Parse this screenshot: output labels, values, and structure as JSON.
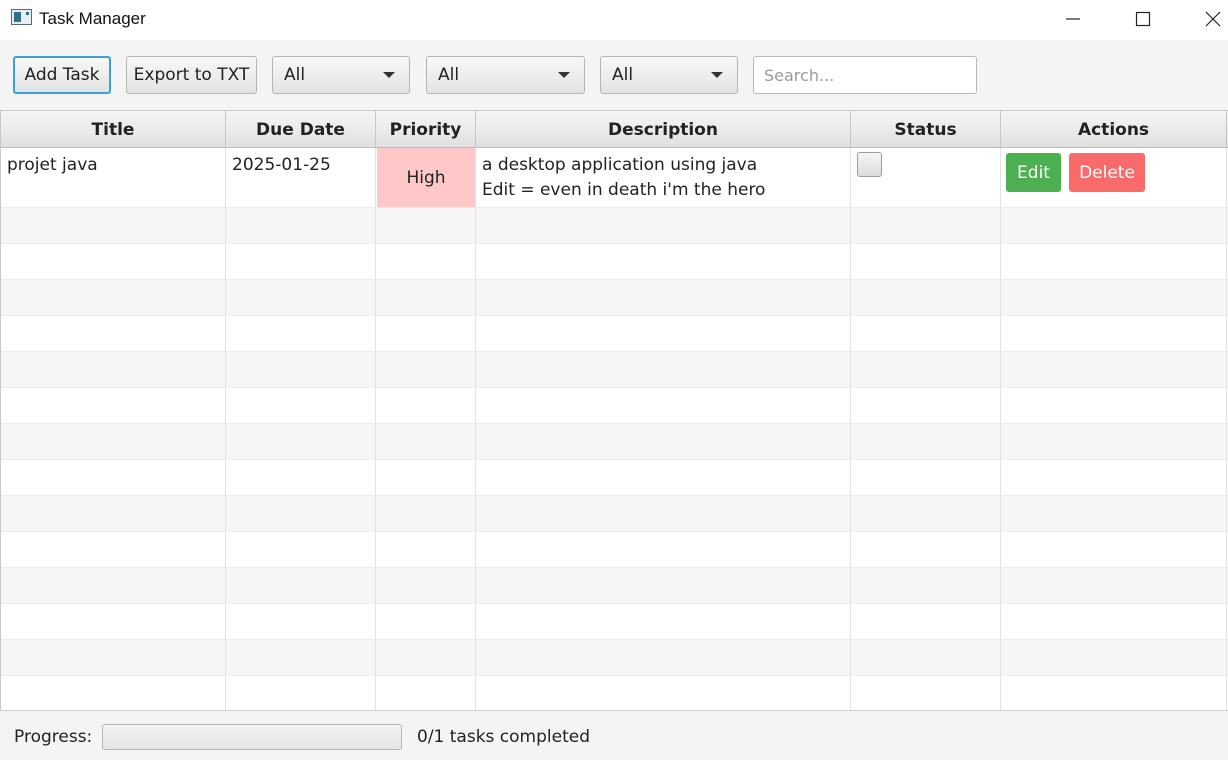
{
  "window": {
    "title": "Task Manager",
    "icon": "app-window-icon"
  },
  "toolbar": {
    "add_label": "Add Task",
    "export_label": "Export to TXT",
    "filter1_value": "All",
    "filter2_value": "All",
    "filter3_value": "All",
    "search_placeholder": "Search...",
    "search_value": ""
  },
  "table": {
    "columns": [
      "Title",
      "Due Date",
      "Priority",
      "Description",
      "Status",
      "Actions"
    ],
    "rows": [
      {
        "title": "projet java",
        "due_date": "2025-01-25",
        "priority": "High",
        "description": [
          "a desktop application using java",
          "Edit = even in death i'm the hero"
        ],
        "completed": false,
        "edit_label": "Edit",
        "delete_label": "Delete"
      }
    ]
  },
  "colors": {
    "priority_high_bg": "#ffc8c8",
    "edit_button": "#4caf50",
    "delete_button": "#f96b6b",
    "focus_accent": "#3aa0d6"
  },
  "footer": {
    "progress_label": "Progress:",
    "progress_fraction": 0,
    "progress_text": "0/1 tasks completed"
  }
}
